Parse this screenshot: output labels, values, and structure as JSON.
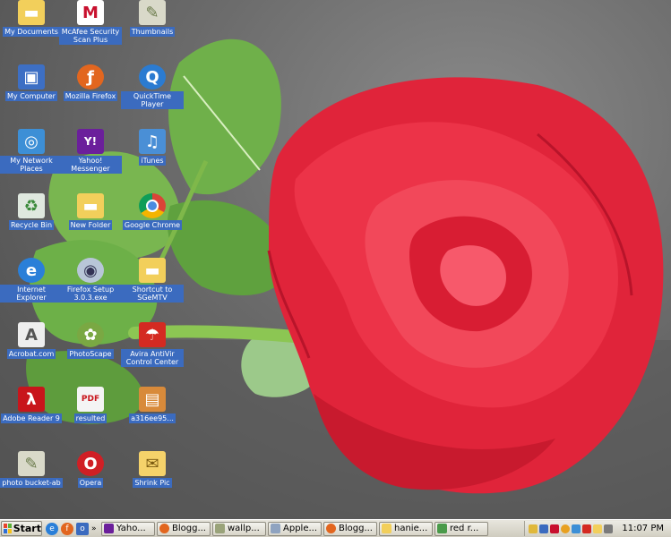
{
  "desktop": {
    "icons": [
      {
        "label": "My Documents",
        "glyph": "folder",
        "color": "#f2cf5b"
      },
      {
        "label": "McAfee Security Scan Plus",
        "glyph": "M",
        "color": "#c8102e"
      },
      {
        "label": "Thumbnails",
        "glyph": "file",
        "color": "#9aa37a"
      },
      {
        "label": "My Computer",
        "glyph": "pc",
        "color": "#3d6fc4"
      },
      {
        "label": "Mozilla Firefox",
        "glyph": "fox",
        "color": "#e2661f"
      },
      {
        "label": "QuickTime Player",
        "glyph": "Q",
        "color": "#2b7bd1"
      },
      {
        "label": "My Network Places",
        "glyph": "net",
        "color": "#3d8fd6"
      },
      {
        "label": "Yahoo! Messenger",
        "glyph": "Y!",
        "color": "#6b1f9b"
      },
      {
        "label": "iTunes",
        "glyph": "♫",
        "color": "#4a8fd6"
      },
      {
        "label": "Recycle Bin",
        "glyph": "♻",
        "color": "#5aa05a"
      },
      {
        "label": "New Folder",
        "glyph": "folder",
        "color": "#f2cf5b"
      },
      {
        "label": "Google Chrome",
        "glyph": "chrome",
        "color": "#4a8be0"
      },
      {
        "label": "Internet Explorer",
        "glyph": "e",
        "color": "#2a7fd8"
      },
      {
        "label": "Firefox Setup 3.0.3.exe",
        "glyph": "cd",
        "color": "#8fa3c0"
      },
      {
        "label": "Shortcut to SGeMTV",
        "glyph": "folder",
        "color": "#f2cf5b"
      },
      {
        "label": "Acrobat.com",
        "glyph": "A",
        "color": "#e8e8e8"
      },
      {
        "label": "PhotoScape",
        "glyph": "ps",
        "color": "#7aa843"
      },
      {
        "label": "Avira AntiVir Control Center",
        "glyph": "☂",
        "color": "#d42a22"
      },
      {
        "label": "Adobe Reader 9",
        "glyph": "pdf",
        "color": "#c8151b"
      },
      {
        "label": "resulted",
        "glyph": "pdf-doc",
        "color": "#f4f4f4"
      },
      {
        "label": "a316ee95...",
        "glyph": "img",
        "color": "#d88a3a"
      },
      {
        "label": "photo bucket-ab",
        "glyph": "file",
        "color": "#9aa37a"
      },
      {
        "label": "Opera",
        "glyph": "O",
        "color": "#d01f25"
      },
      {
        "label": "Shrink Pic",
        "glyph": "env",
        "color": "#f5d26a"
      }
    ]
  },
  "taskbar": {
    "start_label": "Start",
    "quick_launch": [
      {
        "name": "ie-icon",
        "color": "#2a7fd8",
        "glyph": "e"
      },
      {
        "name": "firefox-icon",
        "color": "#e2661f",
        "glyph": "f"
      },
      {
        "name": "outlook-icon",
        "color": "#3b6bbf",
        "glyph": "o"
      }
    ],
    "quick_launch_more": "»",
    "tasks": [
      {
        "label": "Yaho...",
        "color": "#6b1f9b"
      },
      {
        "label": "Blogg...",
        "color": "#e2661f"
      },
      {
        "label": "wallp...",
        "color": "#9aa37a"
      },
      {
        "label": "Apple...",
        "color": "#8fa3c0"
      },
      {
        "label": "Blogg...",
        "color": "#e2661f"
      },
      {
        "label": "hanie...",
        "color": "#f2cf5b"
      },
      {
        "label": "red r...",
        "color": "#4a9a4a"
      }
    ],
    "tray_icons": [
      "#e0b83a",
      "#3b6bbf",
      "#c8102e",
      "#e8a020",
      "#3d8fd6",
      "#d42a22",
      "#f2cf5b",
      "#7a7a7a"
    ],
    "clock": "11:07 PM"
  }
}
